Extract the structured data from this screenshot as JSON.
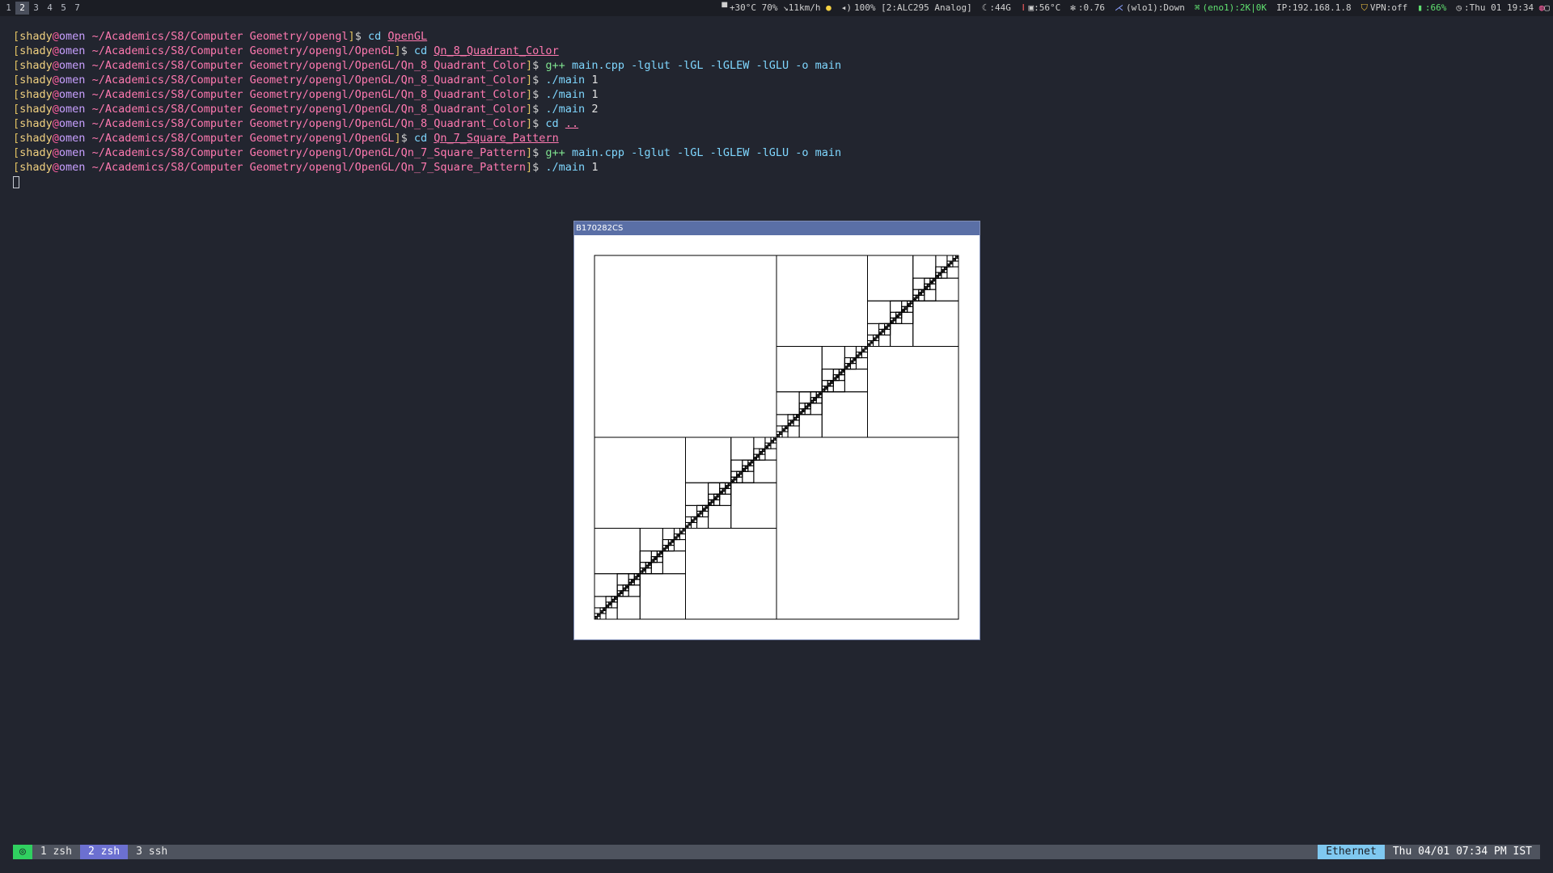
{
  "workspaces": [
    "1",
    "2",
    "3",
    "4",
    "5",
    "7"
  ],
  "active_workspace": "2",
  "status": {
    "weather": "+30°C 70% ↘11km/h",
    "volume": "100% [2:ALC295 Analog]",
    "memory": ":44G",
    "cpu_temp": ":56°C",
    "load": ":0.76",
    "wifi": "(wlo1):Down",
    "ethernet": "(eno1):2K|0K",
    "ip": "IP:192.168.1.8",
    "vpn": "VPN:off",
    "battery": ":66%",
    "clock": ":Thu 01 19:34"
  },
  "terminal": {
    "lines": [
      {
        "path": "~/Academics/S8/Computer Geometry/opengl",
        "cmd": "cd",
        "args": [
          {
            "t": "OpenGL",
            "s": "arg-u"
          }
        ]
      },
      {
        "path": "~/Academics/S8/Computer Geometry/opengl/OpenGL",
        "cmd": "cd",
        "args": [
          {
            "t": "Qn_8_Quadrant_Color",
            "s": "arg-u"
          }
        ]
      },
      {
        "path": "~/Academics/S8/Computer Geometry/opengl/OpenGL/Qn_8_Quadrant_Color",
        "cmd": "g++",
        "args": [
          {
            "t": "main.cpp",
            "s": "flag"
          },
          {
            "t": " -lglut -lGL -lGLEW -lGLU -o main",
            "s": "flag"
          }
        ]
      },
      {
        "path": "~/Academics/S8/Computer Geometry/opengl/OpenGL/Qn_8_Quadrant_Color",
        "cmd": "./main",
        "args": [
          {
            "t": "1",
            "s": "arg"
          }
        ]
      },
      {
        "path": "~/Academics/S8/Computer Geometry/opengl/OpenGL/Qn_8_Quadrant_Color",
        "cmd": "./main",
        "args": [
          {
            "t": "1",
            "s": "arg"
          }
        ]
      },
      {
        "path": "~/Academics/S8/Computer Geometry/opengl/OpenGL/Qn_8_Quadrant_Color",
        "cmd": "./main",
        "args": [
          {
            "t": "2",
            "s": "arg"
          }
        ]
      },
      {
        "path": "~/Academics/S8/Computer Geometry/opengl/OpenGL/Qn_8_Quadrant_Color",
        "cmd": "cd",
        "args": [
          {
            "t": "..",
            "s": "arg-u"
          }
        ]
      },
      {
        "path": "~/Academics/S8/Computer Geometry/opengl/OpenGL",
        "cmd": "cd",
        "args": [
          {
            "t": "Qn_7_Square_Pattern",
            "s": "arg-u"
          }
        ]
      },
      {
        "path": "~/Academics/S8/Computer Geometry/opengl/OpenGL/Qn_7_Square_Pattern",
        "cmd": "g++",
        "args": [
          {
            "t": "main.cpp",
            "s": "flag"
          },
          {
            "t": " -lglut -lGL -lGLEW -lGLU -o main",
            "s": "flag"
          }
        ]
      },
      {
        "path": "~/Academics/S8/Computer Geometry/opengl/OpenGL/Qn_7_Square_Pattern",
        "cmd": "./main",
        "args": [
          {
            "t": "1",
            "s": "arg"
          }
        ]
      }
    ],
    "user": "shady",
    "host": "omen"
  },
  "glwindow": {
    "title": "B170282CS"
  },
  "tmux": {
    "badge": "◎",
    "windows": [
      {
        "label": "1 zsh",
        "active": false
      },
      {
        "label": "2 zsh",
        "active": true
      },
      {
        "label": "3 ssh",
        "active": false
      }
    ],
    "network": "Ethernet",
    "datetime": "Thu 04/01 07:34 PM IST"
  }
}
